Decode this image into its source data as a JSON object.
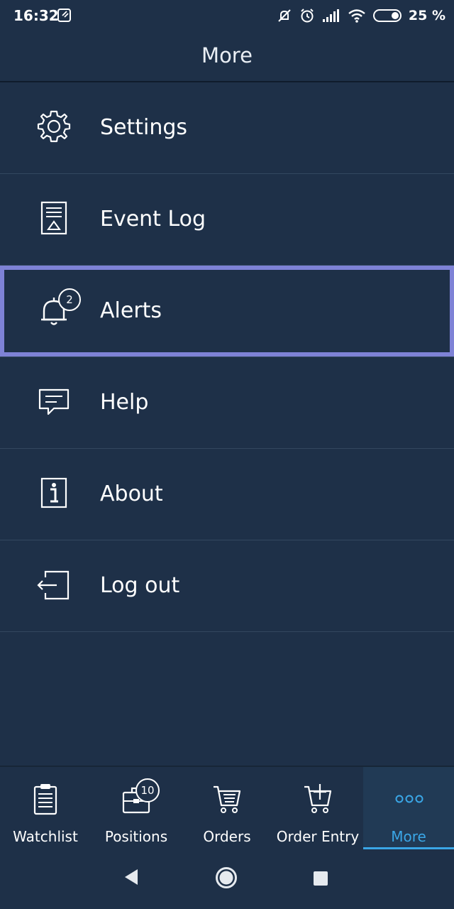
{
  "status_bar": {
    "time": "16:32",
    "battery": "25 %",
    "icons": [
      "dnd-mute-icon",
      "alarm-icon",
      "signal-icon",
      "wifi-icon",
      "battery-icon"
    ]
  },
  "header": {
    "title": "More"
  },
  "menu": {
    "items": [
      {
        "label": "Settings",
        "icon": "gear-icon"
      },
      {
        "label": "Event Log",
        "icon": "document-icon"
      },
      {
        "label": "Alerts",
        "icon": "bell-icon",
        "badge": "2",
        "selected": true
      },
      {
        "label": "Help",
        "icon": "chat-icon"
      },
      {
        "label": "About",
        "icon": "info-icon"
      },
      {
        "label": "Log out",
        "icon": "logout-icon"
      }
    ]
  },
  "bottom_nav": {
    "items": [
      {
        "label": "Watchlist",
        "icon": "clipboard-icon"
      },
      {
        "label": "Positions",
        "icon": "briefcase-icon",
        "badge": "10"
      },
      {
        "label": "Orders",
        "icon": "cart-list-icon"
      },
      {
        "label": "Order Entry",
        "icon": "cart-plus-icon"
      },
      {
        "label": "More",
        "icon": "more-dots-icon",
        "active": true
      }
    ]
  },
  "colors": {
    "background": "#1e3048",
    "accent": "#3aa6e6",
    "selection": "#7e82d6"
  }
}
